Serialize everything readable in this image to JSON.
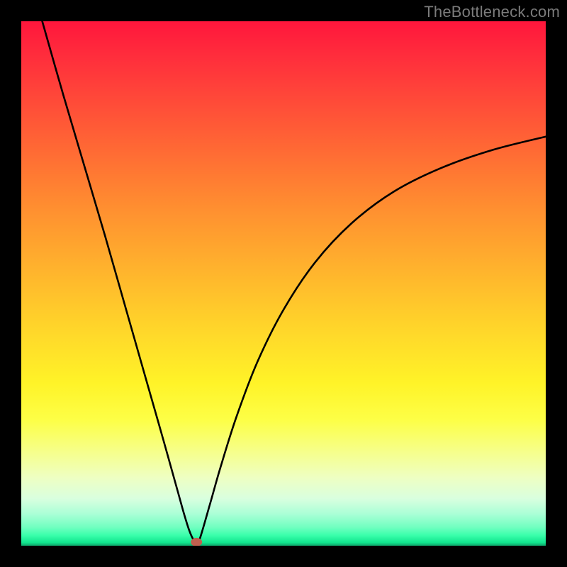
{
  "watermark": "TheBottleneck.com",
  "chart_data": {
    "type": "line",
    "title": "",
    "xlabel": "",
    "ylabel": "",
    "xlim": [
      0,
      100
    ],
    "ylim": [
      0,
      100
    ],
    "legend": false,
    "grid": false,
    "background_gradient": {
      "orientation": "vertical",
      "stops": [
        {
          "pos": 0.0,
          "color": "#ff163c"
        },
        {
          "pos": 0.25,
          "color": "#ff6b34"
        },
        {
          "pos": 0.5,
          "color": "#ffc02b"
        },
        {
          "pos": 0.75,
          "color": "#fcff50"
        },
        {
          "pos": 0.95,
          "color": "#8cffc9"
        },
        {
          "pos": 1.0,
          "color": "#0fa36a"
        }
      ]
    },
    "series": [
      {
        "name": "curve",
        "x": [
          4,
          8,
          12,
          16,
          20,
          24,
          27,
          29.8,
          31,
          32,
          32.8,
          33.4,
          34,
          36,
          38,
          41,
          45,
          50,
          56,
          63,
          71,
          80,
          90,
          100
        ],
        "y": [
          100,
          86,
          72.5,
          59,
          45,
          31,
          20.5,
          10.5,
          6.2,
          3,
          1.2,
          0.7,
          1.2,
          8,
          15,
          24.5,
          35,
          45,
          54,
          61.5,
          67.5,
          72,
          75.5,
          78
        ]
      }
    ],
    "marker": {
      "name": "min-point",
      "x": 33.4,
      "y": 0.7,
      "color": "#c06050"
    }
  }
}
